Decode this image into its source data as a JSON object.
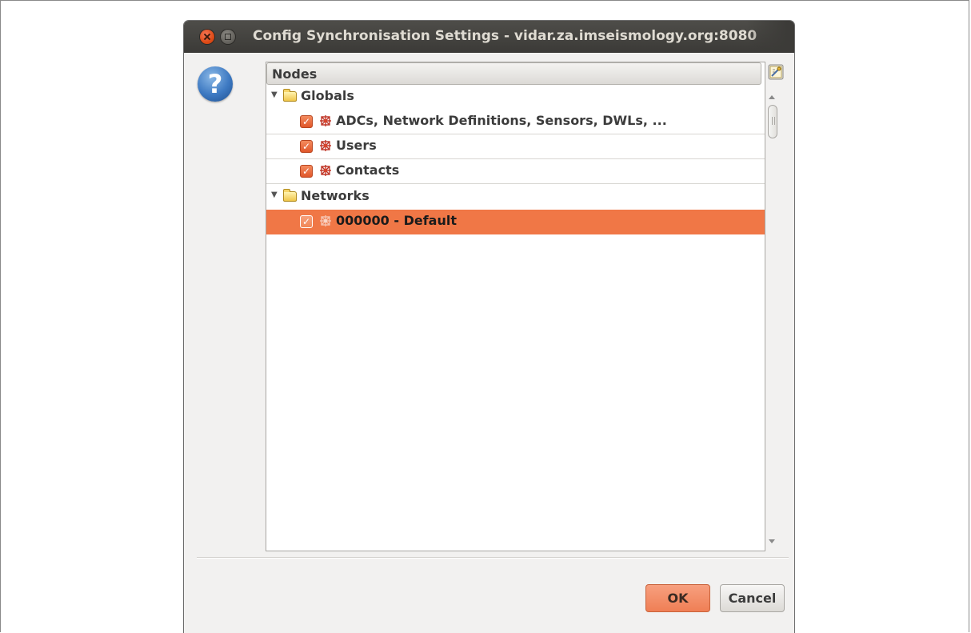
{
  "window": {
    "title": "Config Synchronisation Settings - vidar.za.imseismology.org:8080"
  },
  "tree": {
    "column_header": "Nodes",
    "groups": [
      {
        "label": "Globals",
        "expanded": true,
        "children": [
          {
            "label": "ADCs, Network Definitions, Sensors, DWLs, ...",
            "checked": true
          },
          {
            "label": "Users",
            "checked": true
          },
          {
            "label": "Contacts",
            "checked": true
          }
        ]
      },
      {
        "label": "Networks",
        "expanded": true,
        "children": [
          {
            "label": "000000 - Default",
            "checked": true,
            "selected": true
          }
        ]
      }
    ]
  },
  "buttons": {
    "ok": "OK",
    "cancel": "Cancel"
  },
  "icons": {
    "help": "?",
    "checkmark": "✓",
    "expanded_arrow": "▼"
  },
  "colors": {
    "accent": "#f07746",
    "titlebar": "#3c3b38"
  }
}
